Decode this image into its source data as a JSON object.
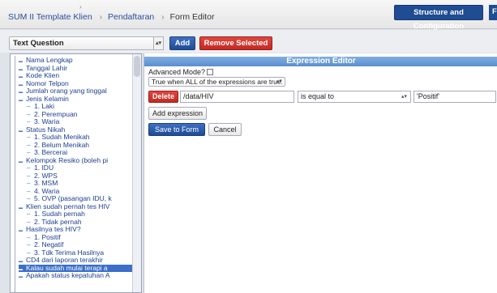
{
  "breadcrumb": {
    "home": "SUM II Template Klien",
    "section": "Pendaftaran",
    "current": "Form Editor",
    "separator": "›"
  },
  "header": {
    "structure_button": "Structure and Configuration",
    "next_tab": "F"
  },
  "toolbar": {
    "question_type": "Text Question",
    "add_label": "Add",
    "remove_label": "Remove Selected"
  },
  "tree": [
    {
      "label": "Nama Lengkap",
      "level": 0
    },
    {
      "label": "Tanggal Lahir",
      "level": 0
    },
    {
      "label": "Kode Klien",
      "level": 0
    },
    {
      "label": "Nomor Telpon",
      "level": 0
    },
    {
      "label": "Jumlah orang yang tinggal",
      "level": 0
    },
    {
      "label": "Jenis Kelamin",
      "level": 0
    },
    {
      "label": "1. Laki",
      "level": 1
    },
    {
      "label": "2. Perempuan",
      "level": 1
    },
    {
      "label": "3. Waria",
      "level": 1
    },
    {
      "label": "Status Nikah",
      "level": 0
    },
    {
      "label": "1. Sudah Menikah",
      "level": 1
    },
    {
      "label": "2. Belum Menikah",
      "level": 1
    },
    {
      "label": "3. Bercerai",
      "level": 1
    },
    {
      "label": "Kelompok Resiko (boleh pi",
      "level": 0
    },
    {
      "label": "1. IDU",
      "level": 1
    },
    {
      "label": "2. WPS",
      "level": 1
    },
    {
      "label": "3. MSM",
      "level": 1
    },
    {
      "label": "4. Waria",
      "level": 1
    },
    {
      "label": "5. OVP (pasangan IDU, k",
      "level": 1
    },
    {
      "label": "Klien sudah pernah tes HIV",
      "level": 0
    },
    {
      "label": "1. Sudah pernah",
      "level": 1
    },
    {
      "label": "2. Tidak pernah",
      "level": 1
    },
    {
      "label": "Hasilnya tes HIV?",
      "level": 0
    },
    {
      "label": "1. Positif",
      "level": 1
    },
    {
      "label": "2. Negatif",
      "level": 1
    },
    {
      "label": "3. Tdk Terima Hasilnya",
      "level": 1
    },
    {
      "label": "CD4 dari laporan terakhir",
      "level": 0
    },
    {
      "label": "Kalau sudah mulai terapi a",
      "level": 0,
      "selected": true
    },
    {
      "label": "Apakah status kepatuhan A",
      "level": 0
    }
  ],
  "editor": {
    "title": "Expression Editor",
    "advanced_mode_label": "Advanced Mode?",
    "mode_value": "True when ALL of the expressions are true.",
    "delete_label": "Delete",
    "path_value": "/data/HIV",
    "operator_value": "is equal to",
    "compare_value": "'Positif'",
    "add_expression_label": "Add expression",
    "save_label": "Save to Form",
    "cancel_label": "Cancel"
  },
  "icons": {
    "select_arrow": "chevron-updown-icon",
    "tree_bullet": "dash-icon",
    "checkbox": "checkbox-icon"
  },
  "colors": {
    "primary": "#1f4c93",
    "danger": "#c42a22",
    "editor_header": "#6a9bd6",
    "selected": "#3b6fc9"
  }
}
